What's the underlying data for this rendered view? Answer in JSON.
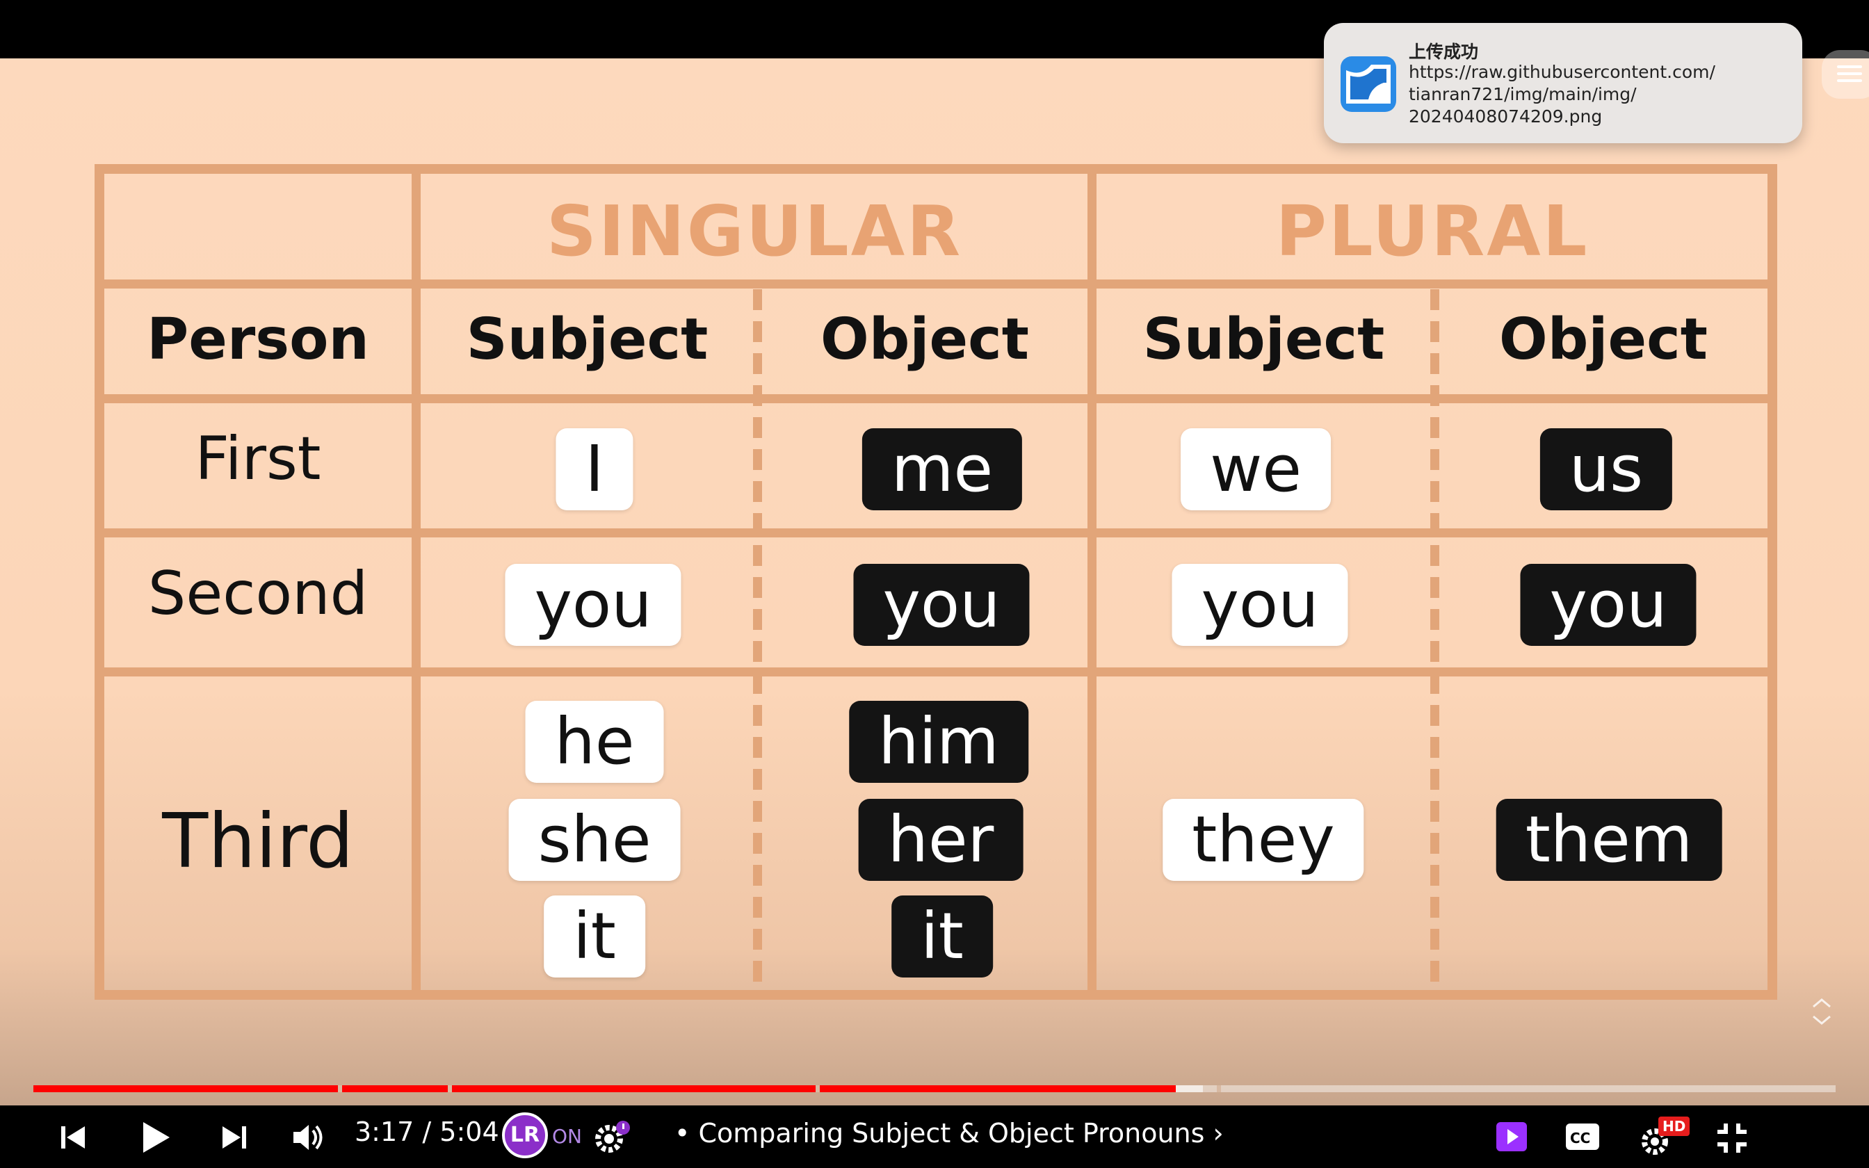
{
  "notification": {
    "title": "上传成功",
    "lines": [
      "https://raw.githubusercontent.com/",
      "tianran721/img/main/img/",
      "20240408074209.png"
    ]
  },
  "table": {
    "groups": [
      "SINGULAR",
      "PLURAL"
    ],
    "person_header": "Person",
    "subject_header": "Subject",
    "object_header": "Object",
    "rows": {
      "first": {
        "label": "First",
        "sing_subj": "I",
        "sing_obj": "me",
        "pl_subj": "we",
        "pl_obj": "us"
      },
      "second": {
        "label": "Second",
        "sing_subj": "you",
        "sing_obj": "you",
        "pl_subj": "you",
        "pl_obj": "you"
      },
      "third": {
        "label": "Third",
        "sing_subj": [
          "he",
          "she",
          "it"
        ],
        "sing_obj": [
          "him",
          "her",
          "it"
        ],
        "pl_subj": "they",
        "pl_obj": "them"
      }
    }
  },
  "player": {
    "time": "3:17 / 5:04",
    "extension_label": "LR",
    "extension_status": "ON",
    "chapter": "• Comparing Subject & Object Pronouns ›",
    "hd": "HD",
    "played_percent": 63.4,
    "buffered_percent": 64.9,
    "colors": {
      "played": "#ff0000",
      "accent_purple": "#8b2fc9"
    },
    "icons": [
      "previous-icon",
      "play-icon",
      "next-icon",
      "volume-icon",
      "settings-icon",
      "miniplayer-icon",
      "captions-icon",
      "quality-settings-icon",
      "exit-fullscreen-icon"
    ]
  }
}
